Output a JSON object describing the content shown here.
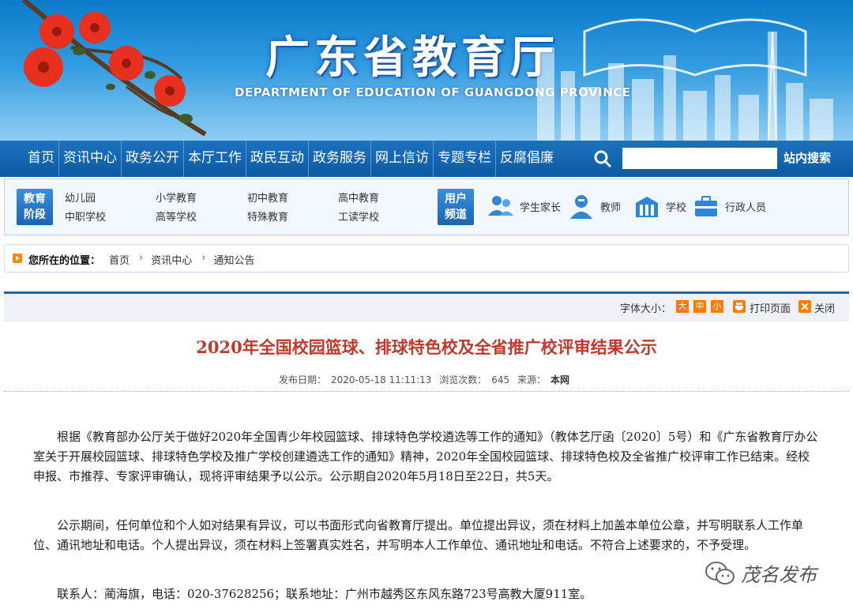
{
  "banner": {
    "title": "广东省教育厅",
    "subtitle": "DEPARTMENT OF EDUCATION OF GUANGDONG PROVINCE"
  },
  "mainnav": {
    "items": [
      "首页",
      "资讯中心",
      "政务公开",
      "本厅工作",
      "政民互动",
      "政务服务",
      "网上信访",
      "专题专栏",
      "反腐倡廉"
    ],
    "search_button": "站内搜索",
    "search_value": ""
  },
  "channels": {
    "edu_badge": [
      "教育",
      "阶段"
    ],
    "edu_links": [
      "幼儿园",
      "小学教育",
      "初中教育",
      "高中教育",
      "中职学校",
      "高等学校",
      "特殊教育",
      "工读学校"
    ],
    "user_badge": [
      "用户",
      "频道"
    ],
    "roles": [
      "学生家长",
      "教师",
      "学校",
      "行政人员"
    ]
  },
  "breadcrumb": {
    "label": "您所在的位置：",
    "items": [
      "首页",
      "资讯中心",
      "通知公告"
    ]
  },
  "toolbar": {
    "font_label": "字体大小：",
    "sizes": [
      "大",
      "中",
      "小"
    ],
    "print": "打印页面",
    "close": "关闭"
  },
  "article": {
    "title": "2020年全国校园篮球、排球特色校及全省推广校评审结果公示",
    "meta": {
      "date_label": "发布日期：",
      "date": "2020-05-18 11:11:13",
      "views_label": "浏览次数：",
      "views": "645",
      "source_label": "来源：",
      "source": "本网"
    },
    "paragraphs": [
      "根据《教育部办公厅关于做好2020年全国青少年校园篮球、排球特色学校遴选等工作的通知》（教体艺厅函〔2020〕5号）和《广东省教育厅办公室关于开展校园篮球、排球特色学校及推广学校创建遴选工作的通知》精神，2020年全国校园篮球、排球特色校及全省推广校评审工作已结束。经校申报、市推荐、专家评审确认，现将评审结果予以公示。公示期自2020年5月18日至22日，共5天。",
      "公示期间，任何单位和个人如对结果有异议，可以书面形式向省教育厅提出。单位提出异议，须在材料上加盖本单位公章，并写明联系人工作单位、通讯地址和电话。个人提出异议，须在材料上签署真实姓名，并写明本人工作单位、通讯地址和电话。不符合上述要求的，不予受理。",
      "联系人：蔺海旗，电话：020-37628256；联系地址：广州市越秀区东风东路723号高教大厦911室。"
    ]
  },
  "watermark": "茂名发布",
  "colors": {
    "nav_blue": "#0b5aa3",
    "title_red": "#c0392b",
    "accent_orange": "#ff7a00"
  }
}
